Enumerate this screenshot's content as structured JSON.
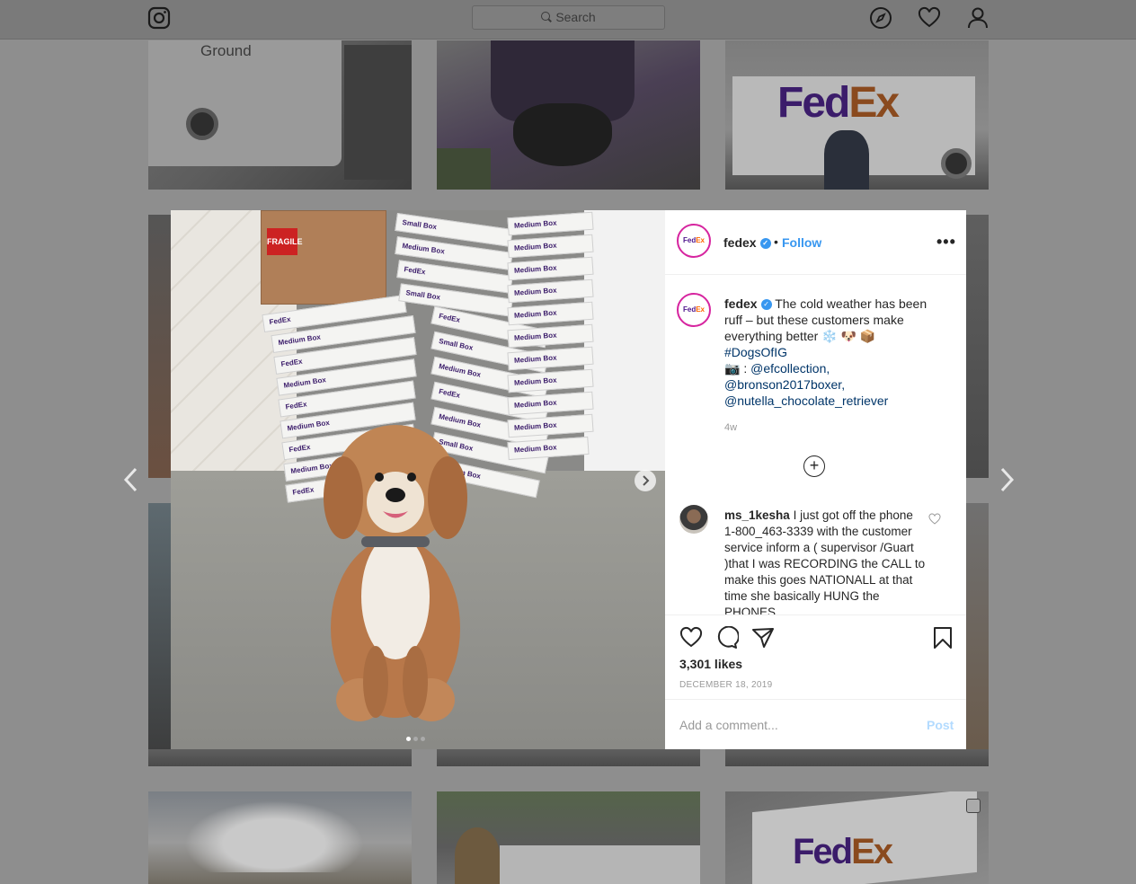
{
  "topbar": {
    "logo_icon": "instagram-icon",
    "search_placeholder": "Search",
    "nav_icons": [
      "compass-icon",
      "heart-icon",
      "profile-icon"
    ]
  },
  "background_grid": {
    "tile_count": 12
  },
  "post": {
    "image": {
      "carousel_dots": 3,
      "active_dot": 1,
      "box_labels": [
        "Medium Box",
        "Small Box",
        "FedEx"
      ],
      "fragile_label": "FRAGILE"
    },
    "header": {
      "avatar_text_fe": "Fed",
      "avatar_text_ex": "Ex",
      "username": "fedex",
      "separator": "•",
      "follow_label": "Follow",
      "more_label": "•••"
    },
    "caption": {
      "username": "fedex",
      "text": "The cold weather has been ruff – but these customers make everything better ❄️ 🐶 📦",
      "hashtag": "#DogsOfIG",
      "credit_prefix": "📷 :",
      "mentions": [
        "@efcollection,",
        "@bronson2017boxer,",
        "@nutella_chocolate_retriever"
      ],
      "time": "4w"
    },
    "load_more_label": "+",
    "comment": {
      "username": "ms_1kesha",
      "text": "I just got off the phone 1-800_463-3339 with the customer service inform a ( supervisor /Guart )that I was RECORDING the CALL to make this goes NATIONALL at that time she basically HUNG the PHONES"
    },
    "actions": {
      "icons": [
        "heart-icon",
        "comment-icon",
        "share-icon",
        "bookmark-icon"
      ],
      "likes": "3,301 likes",
      "date": "DECEMBER 18, 2019"
    },
    "add_comment": {
      "placeholder": "Add a comment...",
      "post_label": "Post"
    }
  },
  "colors": {
    "accent_blue": "#3897f0",
    "post_disabled": "#b3dbff",
    "fedex_purple": "#4d148c",
    "fedex_orange": "#ff6600"
  }
}
